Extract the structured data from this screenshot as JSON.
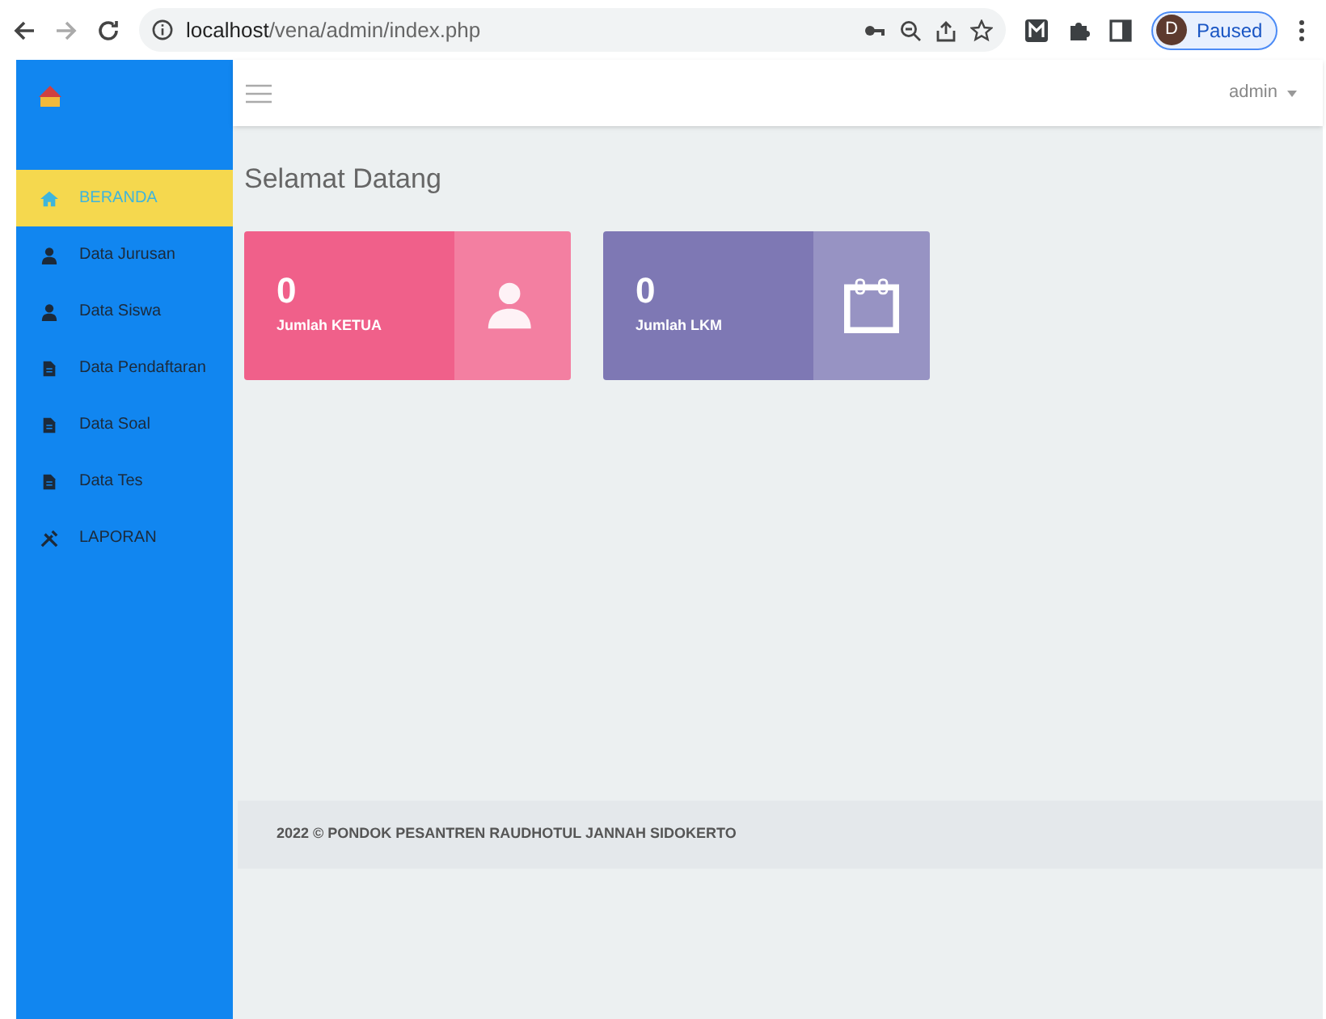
{
  "browser": {
    "url_host": "localhost",
    "url_path": "/vena/admin/index.php",
    "profile_initial": "D",
    "profile_status": "Paused"
  },
  "sidebar": {
    "items": [
      {
        "label": "BERANDA",
        "kind": "home",
        "selected": true
      },
      {
        "label": "Data Jurusan",
        "kind": "user",
        "selected": false
      },
      {
        "label": "Data Siswa",
        "kind": "user",
        "selected": false
      },
      {
        "label": "Data Pendaftaran",
        "kind": "file",
        "selected": false
      },
      {
        "label": "Data Soal",
        "kind": "file",
        "selected": false
      },
      {
        "label": "Data Tes",
        "kind": "file",
        "selected": false
      },
      {
        "label": "LAPORAN",
        "kind": "tools",
        "selected": false
      }
    ]
  },
  "header": {
    "user": "admin"
  },
  "page_title": "Selamat Datang",
  "cards": [
    {
      "value": "0",
      "label": "Jumlah KETUA",
      "kind": "user",
      "color": "#f0608a"
    },
    {
      "value": "0",
      "label": "Jumlah LKM",
      "kind": "calendar",
      "color": "#7e78b4"
    }
  ],
  "footer": "2022 © PONDOK PESANTREN RAUDHOTUL JANNAH SIDOKERTO"
}
